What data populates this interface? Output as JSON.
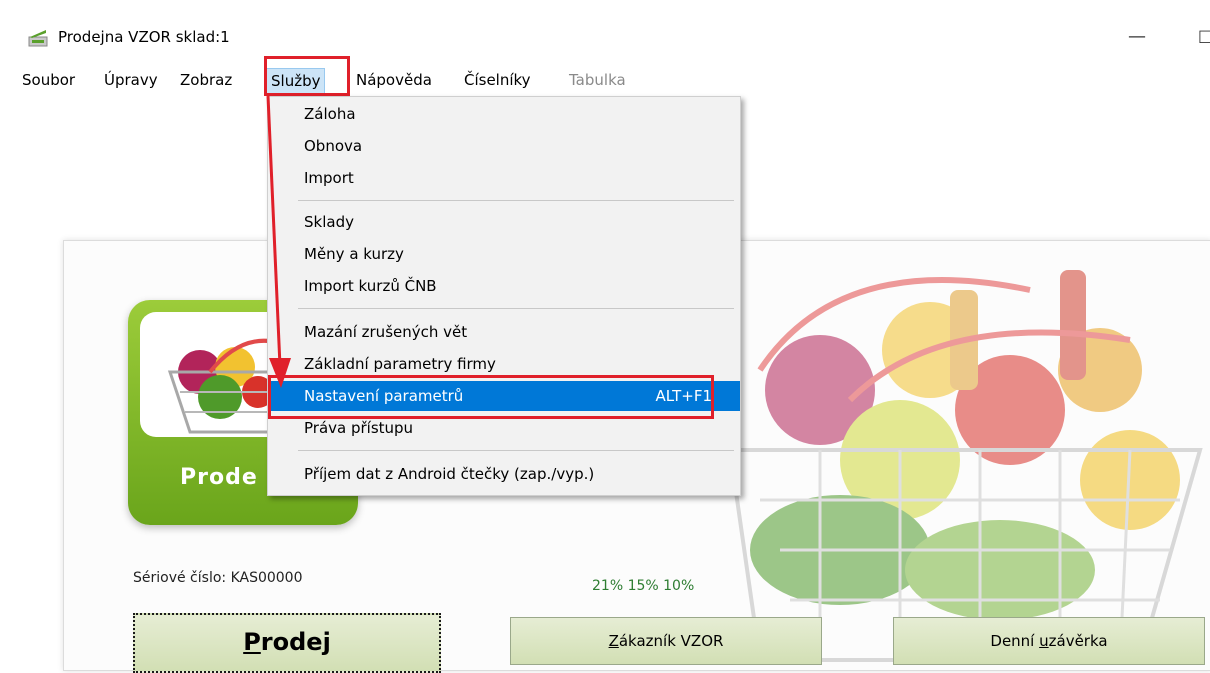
{
  "window": {
    "title": "Prodejna VZOR sklad:1",
    "minimize_glyph": "—",
    "maximize_glyph": "□"
  },
  "menubar": {
    "items": [
      {
        "label": "Soubor"
      },
      {
        "label": "Úpravy"
      },
      {
        "label": "Zobraz"
      },
      {
        "label": "Služby"
      },
      {
        "label": "Nápověda"
      },
      {
        "label": "Číselníky"
      },
      {
        "label": "Tabulka"
      }
    ]
  },
  "sluzby_menu": {
    "items": [
      {
        "label": "Záloha"
      },
      {
        "label": "Obnova"
      },
      {
        "label": "Import"
      },
      {
        "label": "Sklady"
      },
      {
        "label": "Měny a kurzy"
      },
      {
        "label": "Import kurzů ČNB"
      },
      {
        "label": "Mazání zrušených vět"
      },
      {
        "label": "Základní parametry firmy"
      },
      {
        "label": "Nastavení parametrů",
        "shortcut": "ALT+F1"
      },
      {
        "label": "Práva přístupu"
      },
      {
        "label": "Příjem dat z Android čtečky (zap./vyp.)"
      }
    ]
  },
  "main": {
    "logo_text": "Prode",
    "serial": "Sériové číslo: KAS00000",
    "vat_rates": "21%  15%  10%",
    "buttons": {
      "prodej_first": "P",
      "prodej_rest": "rodej",
      "zakaznik_first": "Z",
      "zakaznik_rest": "ákazník  VZOR",
      "uzaverka_pre": "Denní ",
      "uzaverka_ul": "u",
      "uzaverka_rest": "závěrka"
    }
  },
  "colors": {
    "highlight": "#0078d7",
    "annotation_red": "#e0202a",
    "logo_green": "#7cb928",
    "button_green": "#d2dfb4"
  }
}
